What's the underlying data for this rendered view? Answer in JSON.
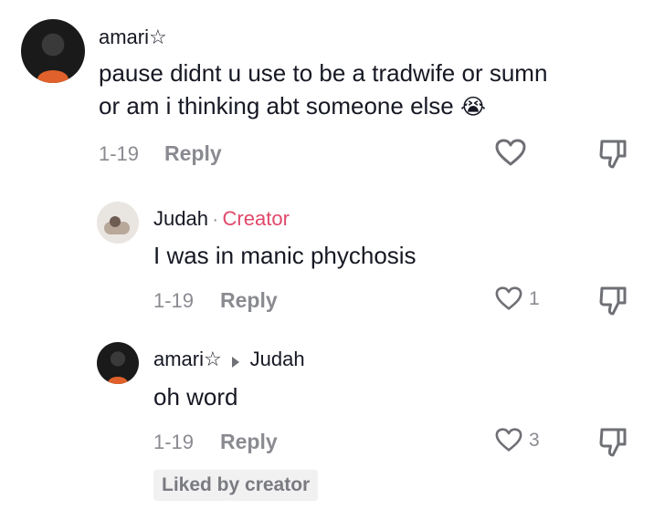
{
  "comments": [
    {
      "username": "amari",
      "user_badge": "☆",
      "text_line1": "pause didnt u use to be a tradwife or sumn",
      "text_line2": "or am i thinking abt someone else",
      "emoji": "😭",
      "date": "1-19",
      "reply_label": "Reply"
    },
    {
      "username": "Judah",
      "separator": "·",
      "role_badge": "Creator",
      "text": "I was in manic phychosis",
      "date": "1-19",
      "reply_label": "Reply",
      "like_count": "1"
    },
    {
      "username": "amari",
      "user_badge": "☆",
      "reply_to": "Judah",
      "text": "oh word",
      "date": "1-19",
      "reply_label": "Reply",
      "like_count": "3",
      "liked_by": "Liked by creator"
    }
  ],
  "icons": {
    "like": "heart-outline-icon",
    "dislike": "thumbs-down-icon",
    "reply_arrow": "triangle-right-icon"
  },
  "colors": {
    "creator_accent": "#e0486a",
    "muted_text": "#8a8b91"
  }
}
